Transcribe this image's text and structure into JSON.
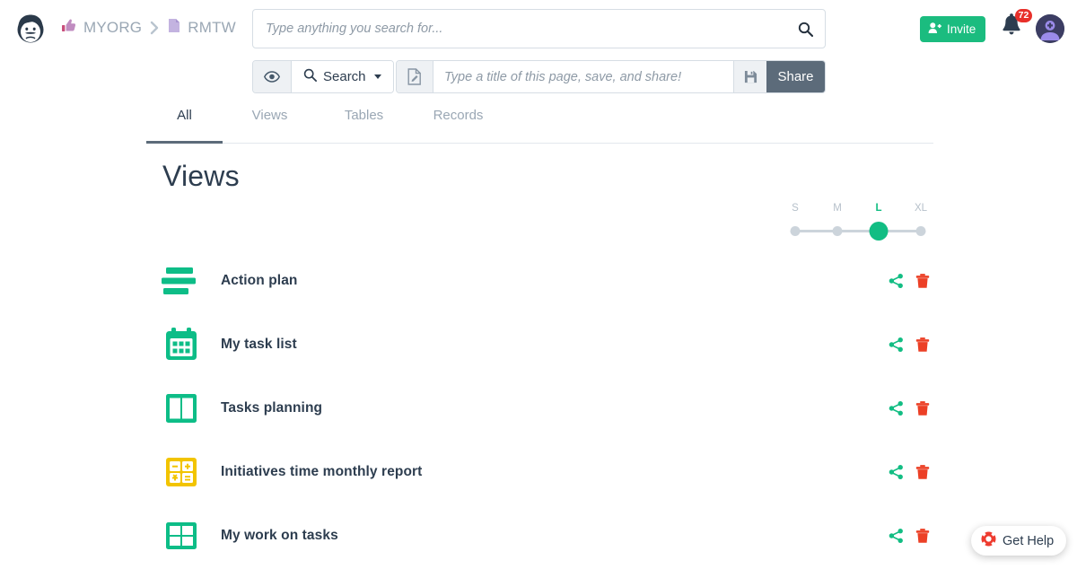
{
  "topbar": {
    "brand_avatar_icon": "user-face-avatar-icon",
    "breadcrumb": [
      {
        "label": "MYORG",
        "icon": "thumbs-up-icon"
      },
      {
        "label": "RMTW",
        "icon": "document-icon"
      }
    ],
    "breadcrumb_separator": "›",
    "search": {
      "placeholder": "Type anything you search for...",
      "value": "",
      "icon": "search-icon"
    },
    "invite": {
      "label": "Invite",
      "icon": "user-plus-icon",
      "color": "#1bbc7f"
    },
    "notifications": {
      "count": "72",
      "icon": "bell-icon",
      "badge_color": "#e8302a"
    },
    "user_avatar_icon": "user-avatar-icon"
  },
  "toolbar": {
    "preview_icon": "eye-icon",
    "search_dropdown": {
      "label": "Search",
      "icon": "search-icon",
      "caret": "chevron-down-icon"
    },
    "page_icon": "page-edit-icon",
    "title_field": {
      "placeholder": "Type a title of this page, save, and share!",
      "value": ""
    },
    "save_icon": "floppy-disk-icon",
    "share_label": "Share"
  },
  "tabs": [
    {
      "label": "All",
      "active": true
    },
    {
      "label": "Views",
      "active": false
    },
    {
      "label": "Tables",
      "active": false
    },
    {
      "label": "Records",
      "active": false
    }
  ],
  "content": {
    "title": "Views",
    "size_selector": {
      "options": [
        "S",
        "M",
        "L",
        "XL"
      ],
      "selected": "L",
      "accent_color": "#12bd83"
    },
    "views": [
      {
        "label": "Action plan",
        "icon": "list-bars-icon",
        "color": "#0dbd87"
      },
      {
        "label": "My task list",
        "icon": "calendar-icon",
        "color": "#0dbd87"
      },
      {
        "label": "Tasks planning",
        "icon": "two-column-board-icon",
        "color": "#0dbd87"
      },
      {
        "label": "Initiatives time monthly report",
        "icon": "calculator-icon",
        "color": "#f2c400"
      },
      {
        "label": "My work on tasks",
        "icon": "grid-table-icon",
        "color": "#0dbd87"
      }
    ],
    "row_actions": {
      "share_icon": "share-nodes-icon",
      "share_color": "#12bd83",
      "delete_icon": "trash-icon",
      "delete_color": "#ec4026"
    }
  },
  "help_widget": {
    "label": "Get Help",
    "icon": "lifebuoy-icon",
    "color": "#ee3b2f"
  }
}
